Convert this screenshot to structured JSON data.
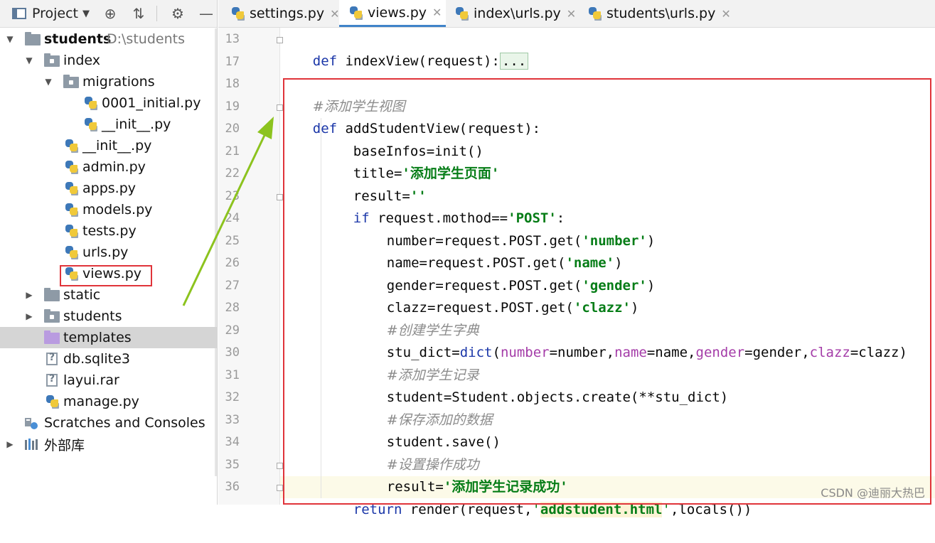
{
  "project_panel": {
    "title": "Project",
    "tree": [
      {
        "label": "students",
        "path": "D:\\students"
      },
      {
        "label": "index"
      },
      {
        "label": "migrations"
      },
      {
        "label": "0001_initial.py"
      },
      {
        "label": "__init__.py"
      },
      {
        "label": "__init__.py"
      },
      {
        "label": "admin.py"
      },
      {
        "label": "apps.py"
      },
      {
        "label": "models.py"
      },
      {
        "label": "tests.py"
      },
      {
        "label": "urls.py"
      },
      {
        "label": "views.py"
      },
      {
        "label": "static"
      },
      {
        "label": "students"
      },
      {
        "label": "templates"
      },
      {
        "label": "db.sqlite3"
      },
      {
        "label": "layui.rar"
      },
      {
        "label": "manage.py"
      },
      {
        "label": "Scratches and Consoles"
      },
      {
        "label": "外部库"
      }
    ]
  },
  "tabs": [
    {
      "label": "settings.py",
      "active": false
    },
    {
      "label": "views.py",
      "active": true
    },
    {
      "label": "index\\urls.py",
      "active": false
    },
    {
      "label": "students\\urls.py",
      "active": false
    }
  ],
  "line_numbers": [
    "13",
    "17",
    "18",
    "19",
    "20",
    "21",
    "22",
    "23",
    "24",
    "25",
    "26",
    "27",
    "28",
    "29",
    "30",
    "31",
    "32",
    "33",
    "34",
    "35",
    "36"
  ],
  "code": {
    "l13_kw": "def",
    "l13_rest": " indexView(request):",
    "l13_ellipsis": "...",
    "l18": "#添加学生视图",
    "l19_kw": "def",
    "l19_rest": " addStudentView(request):",
    "l20": "baseInfos=init()",
    "l21_a": "title=",
    "l21_s": "'添加学生页面'",
    "l22_a": "result=",
    "l22_s": "''",
    "l23_kw": "if",
    "l23_a": " request.mothod==",
    "l23_s": "'POST'",
    "l23_b": ":",
    "l24_a": "number=request.POST.get(",
    "l24_s": "'number'",
    "l24_b": ")",
    "l25_a": "name=request.POST.get(",
    "l25_s": "'name'",
    "l25_b": ")",
    "l26_a": "gender=request.POST.get(",
    "l26_s": "'gender'",
    "l26_b": ")",
    "l27_a": "clazz=request.POST.get(",
    "l27_s": "'clazz'",
    "l27_b": ")",
    "l28": "#创建学生字典",
    "l29_a": "stu_dict=",
    "l29_dict": "dict",
    "l29_p": "(",
    "l29_k1": "number",
    "l29_v1": "=number,",
    "l29_k2": "name",
    "l29_v2": "=name,",
    "l29_k3": "gender",
    "l29_v3": "=gender,",
    "l29_k4": "clazz",
    "l29_v4": "=clazz)",
    "l30": "#添加学生记录",
    "l31": "student=Student.objects.create(**stu_dict)",
    "l32": "#保存添加的数据",
    "l33": "student.save()",
    "l34": "#设置操作成功",
    "l35_a": "result=",
    "l35_s": "'添加学生记录成功'",
    "l36_kw": "return",
    "l36_a": " render(request,",
    "l36_q1": "'",
    "l36_s": "addstudent.html",
    "l36_q2": "'",
    "l36_b": ",locals())"
  },
  "watermark": "CSDN @迪丽大热巴",
  "colors": {
    "highlight_box": "#e0343a",
    "arrow": "#8cc31e",
    "keyword": "#1a36a8",
    "string": "#067d17"
  }
}
